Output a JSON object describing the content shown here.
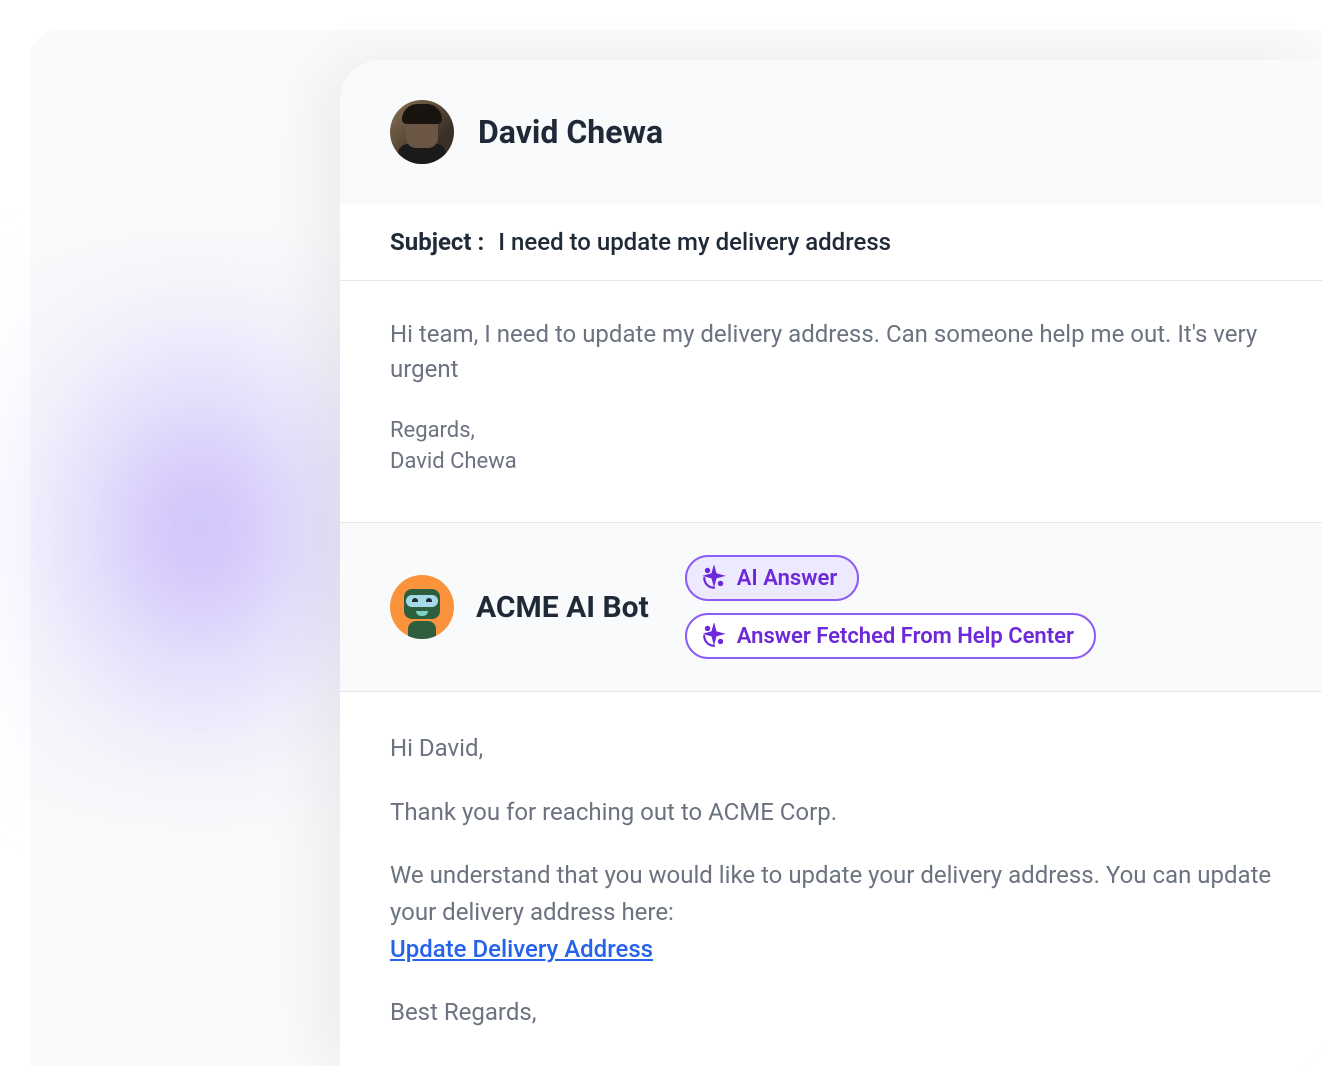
{
  "sender": {
    "name": "David Chewa"
  },
  "subject": {
    "label": "Subject :",
    "text": "I need to update my delivery address"
  },
  "message": {
    "body": "Hi team, I need to update my delivery address. Can someone help me out. It's very urgent",
    "signature_line1": "Regards,",
    "signature_line2": "David Chewa"
  },
  "bot": {
    "name": "ACME AI Bot",
    "badges": {
      "ai_answer": "AI Answer",
      "help_center": "Answer Fetched From Help Center"
    },
    "response": {
      "greeting": "Hi David,",
      "thanks": "Thank you for reaching out to ACME Corp.",
      "body_part1": "We understand that you would like to update your delivery address. You can update your delivery address here: ",
      "link_text": "Update Delivery Address",
      "closing": "Best Regards,"
    }
  }
}
